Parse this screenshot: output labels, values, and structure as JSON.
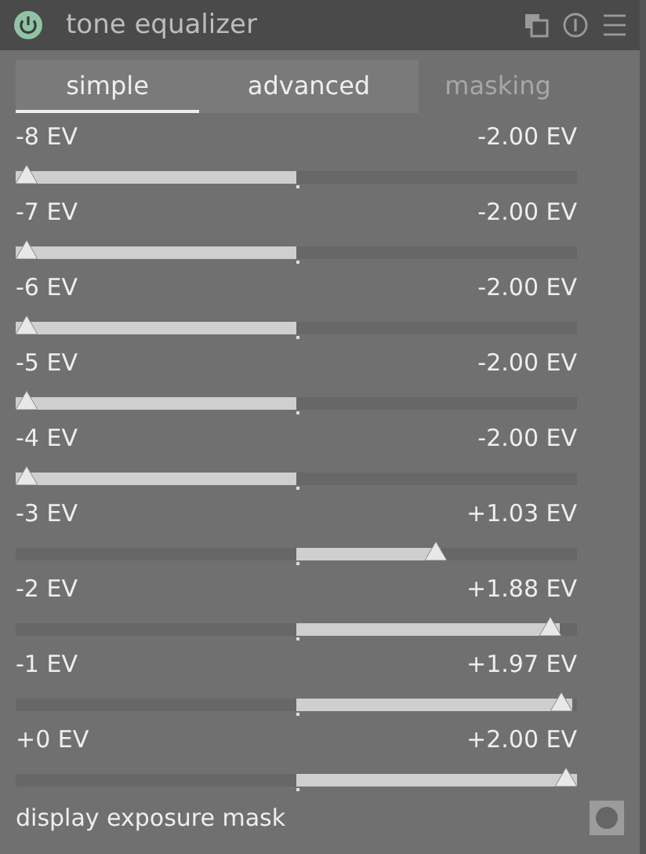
{
  "header": {
    "title": "tone equalizer",
    "on": true
  },
  "tabs": [
    {
      "label": "simple",
      "selected": true
    },
    {
      "label": "advanced",
      "selected": false
    },
    {
      "label": "masking",
      "selected": false
    }
  ],
  "sliders": [
    {
      "label": "-8 EV",
      "reading": "-2.00 EV",
      "level": 0
    },
    {
      "label": "-7 EV",
      "reading": "-2.00 EV",
      "level": 0
    },
    {
      "label": "-6 EV",
      "reading": "-2.00 EV",
      "level": 0
    },
    {
      "label": "-5 EV",
      "reading": "-2.00 EV",
      "level": 0
    },
    {
      "label": "-4 EV",
      "reading": "-2.00 EV",
      "level": 0
    },
    {
      "label": "-3 EV",
      "reading": "+1.03 EV",
      "level": 0.7575
    },
    {
      "label": "-2 EV",
      "reading": "+1.88 EV",
      "level": 0.97
    },
    {
      "label": "-1 EV",
      "reading": "+1.97 EV",
      "level": 0.9925
    },
    {
      "label": "+0 EV",
      "reading": "+2.00 EV",
      "level": 1
    }
  ],
  "mask_toggle": {
    "label": "display exposure mask",
    "on": false
  }
}
